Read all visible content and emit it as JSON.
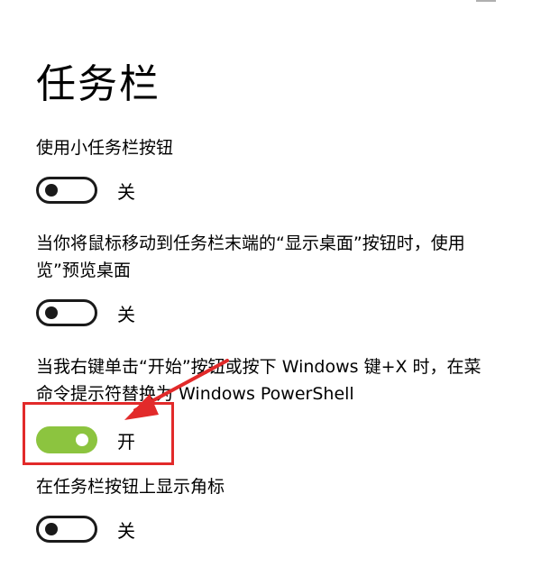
{
  "page": {
    "title": "任务栏"
  },
  "settings": [
    {
      "label": "使用小任务栏按钮",
      "state_label": "关",
      "on": false
    },
    {
      "label_lines": [
        "当你将鼠标移动到任务栏末端的“显示桌面”按钮时，使用",
        "览”预览桌面"
      ],
      "state_label": "关",
      "on": false
    },
    {
      "label_lines": [
        "当我右键单击“开始”按钮或按下 Windows 键+X 时，在菜",
        "命令提示符替换为 Windows PowerShell"
      ],
      "state_label": "开",
      "on": true
    },
    {
      "label": "在任务栏按钮上显示角标",
      "state_label": "关",
      "on": false
    }
  ],
  "colors": {
    "toggle_on": "#8cc43f",
    "annotation": "#e22a2a"
  }
}
